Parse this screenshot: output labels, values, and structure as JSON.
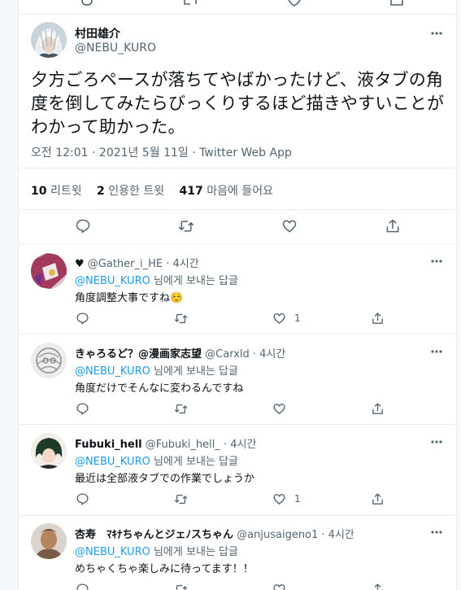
{
  "main_tweet": {
    "display_name": "村田雄介",
    "handle": "@NEBU_KURO",
    "text_line1": "夕方ごろペースが落ちてやばかったけど、液タブの角",
    "text_line2": "度を倒してみたらびっくりするほど描きやすいことが",
    "text_line3": "わかって助かった。",
    "timestamp": "오전 12:01 · 2021년 5월 11일 · Twitter Web App",
    "stats": {
      "retweets_count": "10",
      "retweets_label": "리트윗",
      "quotes_count": "2",
      "quotes_label": "인용한 트윗",
      "likes_count": "417",
      "likes_label": "마음에 들어요"
    }
  },
  "replies": [
    {
      "display_name": "♥",
      "handle": "@Gather_i_HE · 4시간",
      "replying_mention": "@NEBU_KURO",
      "replying_suffix": "님에게 보내는 답글",
      "text": "角度調整大事ですね☺️",
      "like_count": "1"
    },
    {
      "display_name": "きゃろるど？@漫画家志望",
      "handle": "@Carxld · 4시간",
      "replying_mention": "@NEBU_KURO",
      "replying_suffix": "님에게 보내는 답글",
      "text": "角度だけでそんなに変わるんですね",
      "like_count": ""
    },
    {
      "display_name": "Fubuki_hell",
      "handle": "@Fubuki_hell_ · 4시간",
      "replying_mention": "@NEBU_KURO",
      "replying_suffix": "님에게 보내는 답글",
      "text": "最近は全部液タブでの作業でしょうか",
      "like_count": "1"
    },
    {
      "display_name": "杏寿　ﾏｷﾅちゃんとジェﾉスちゃん",
      "handle": "@anjusaigeno1 · 4시간",
      "replying_mention": "@NEBU_KURO",
      "replying_suffix": "님에게 보내는 답글",
      "text": "めちゃくちゃ楽しみに待ってます！！",
      "like_count": ""
    }
  ],
  "colors": {
    "accent": "#1d9bf0",
    "text_secondary": "#536471",
    "border": "#ebeef0"
  },
  "icons": [
    "reply-icon",
    "retweet-icon",
    "like-icon",
    "share-icon",
    "more-icon"
  ]
}
